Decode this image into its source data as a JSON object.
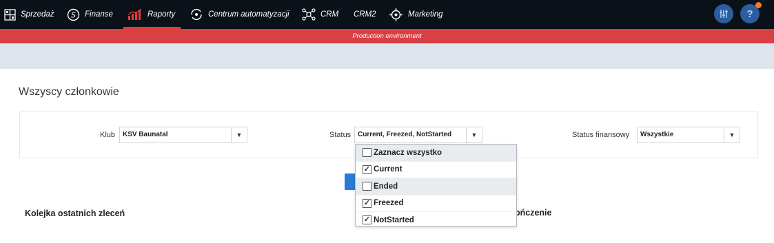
{
  "nav": {
    "items": [
      {
        "label": "Sprzedaż",
        "icon": "grid-icon"
      },
      {
        "label": "Finanse",
        "icon": "dollar-circle-icon"
      },
      {
        "label": "Raporty",
        "icon": "bar-chart-icon",
        "active": true
      },
      {
        "label": "Centrum automatyzacji",
        "icon": "sync-circle-icon"
      },
      {
        "label": "CRM",
        "icon": "network-icon"
      },
      {
        "label": "CRM2",
        "icon": ""
      },
      {
        "label": "Marketing",
        "icon": "compass-icon"
      }
    ],
    "right": {
      "settings_icon": "sliders-icon",
      "help_label": "?"
    }
  },
  "env_banner": "Production environment",
  "page_title": "Wszyscy członkowie",
  "filters": {
    "club": {
      "label": "Klub",
      "value": "KSV Baunatal"
    },
    "status": {
      "label": "Status",
      "value": "Current, Freezed, NotStarted"
    },
    "finance_status": {
      "label": "Status finansowy",
      "value": "Wszystkie"
    }
  },
  "status_dropdown": {
    "items": [
      {
        "label": "Zaznacz wszystko",
        "checked": false
      },
      {
        "label": "Current",
        "checked": true
      },
      {
        "label": "Ended",
        "checked": false
      },
      {
        "label": "Freezed",
        "checked": true
      },
      {
        "label": "NotStarted",
        "checked": true
      }
    ]
  },
  "sections": {
    "left_title": "Kolejka ostatnich zleceń",
    "right_title_partial": "ończenie"
  },
  "colors": {
    "nav_bg": "#0b1118",
    "env_banner_bg": "#d94044",
    "active_underline": "#e63c3c",
    "button_blue": "#2a7ad8"
  }
}
